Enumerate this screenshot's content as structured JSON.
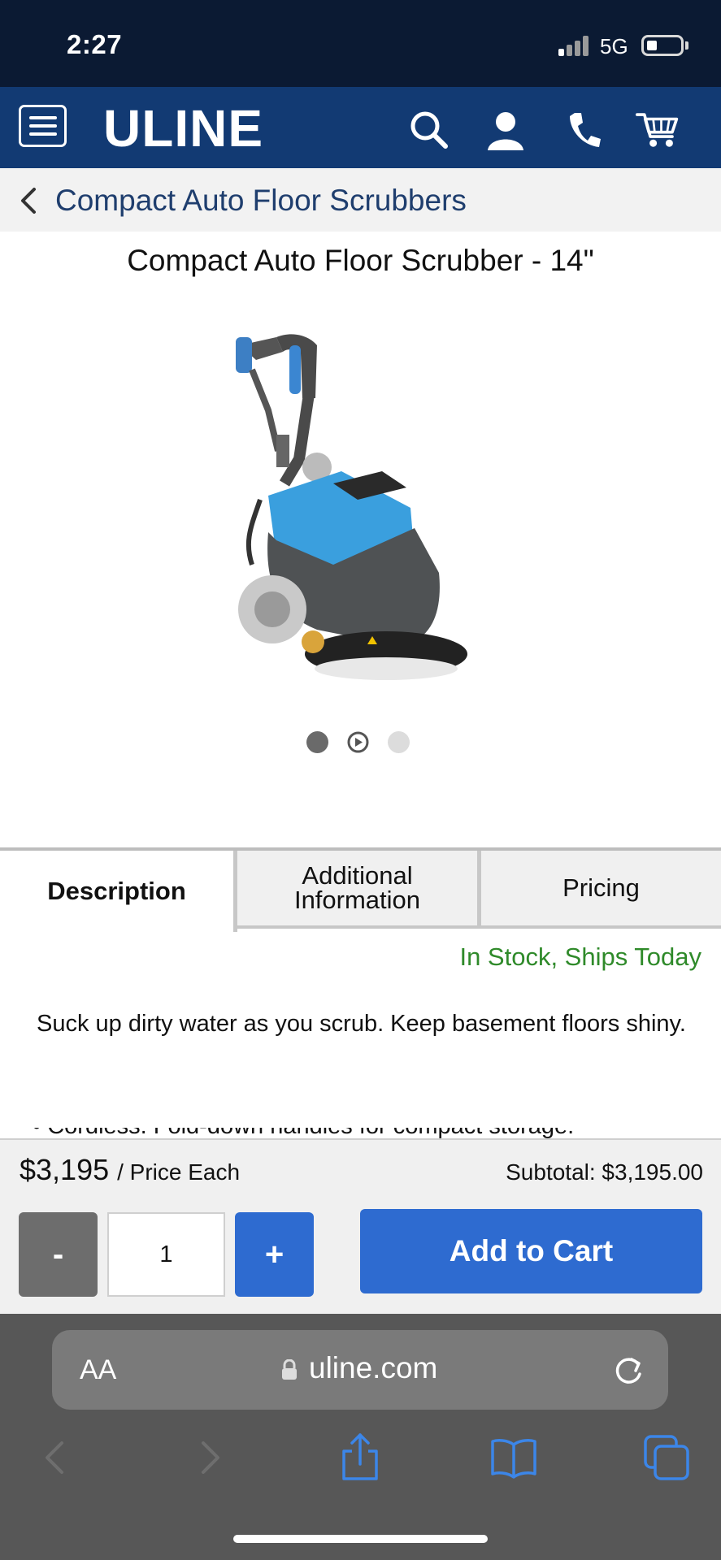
{
  "status": {
    "time": "2:27",
    "network": "5G"
  },
  "header": {
    "logo": "ULINE"
  },
  "breadcrumb": {
    "label": "Compact Auto Floor Scrubbers"
  },
  "product": {
    "title": "Compact Auto Floor Scrubber - 14\"",
    "stock": "In Stock, Ships Today",
    "description": "Suck up dirty water as you scrub. Keep basement floors shiny.",
    "bullet_partial": "Cordless. Fold-down handles for compact storage."
  },
  "carousel": {
    "total": 3,
    "active_index": 0
  },
  "tabs": [
    {
      "label": "Description",
      "active": true
    },
    {
      "label": "Additional Information",
      "active": false
    },
    {
      "label": "Pricing",
      "active": false
    }
  ],
  "cart": {
    "price": "$3,195",
    "price_unit": "/ Price Each",
    "subtotal": "Subtotal: $3,195.00",
    "minus_label": "-",
    "quantity": "1",
    "plus_label": "+",
    "add_label": "Add to Cart"
  },
  "safari": {
    "aa": "AA",
    "url": "uline.com"
  },
  "colors": {
    "header": "#123a73",
    "accent": "#2e6bd0",
    "stock": "#2f8a2a"
  }
}
